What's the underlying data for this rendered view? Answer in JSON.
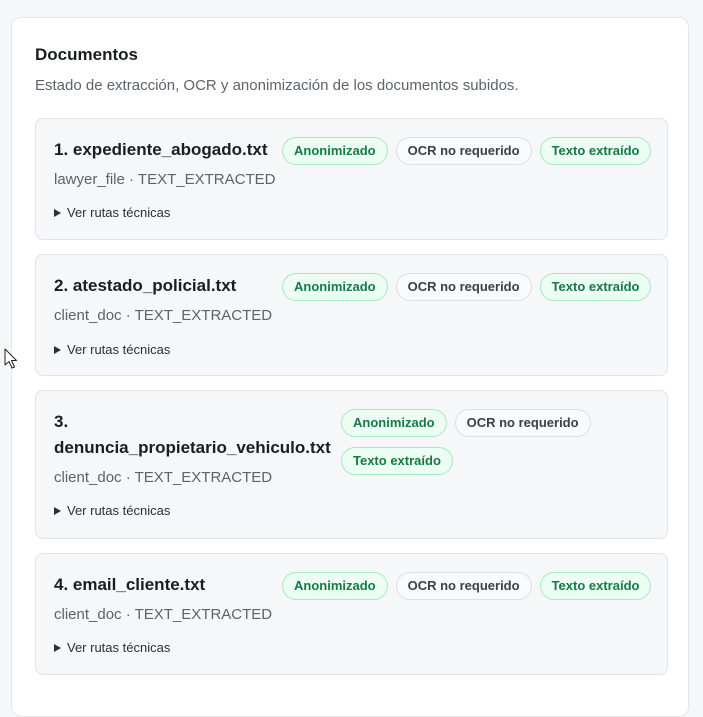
{
  "panel": {
    "title": "Documentos",
    "subtitle": "Estado de extracción, OCR y anonimización de los documentos subidos."
  },
  "documents": [
    {
      "title": "1. expediente_abogado.txt",
      "meta": "lawyer_file · TEXT_EXTRACTED",
      "badges": [
        "Anonimizado",
        "OCR no requerido",
        "Texto extraído"
      ],
      "details": "Ver rutas técnicas"
    },
    {
      "title": "2. atestado_policial.txt",
      "meta": "client_doc · TEXT_EXTRACTED",
      "badges": [
        "Anonimizado",
        "OCR no requerido",
        "Texto extraído"
      ],
      "details": "Ver rutas técnicas"
    },
    {
      "title_line1": "3.",
      "title_line2": "denuncia_propietario_vehiculo.txt",
      "meta": "client_doc · TEXT_EXTRACTED",
      "badges": [
        "Anonimizado",
        "OCR no requerido",
        "Texto extraído"
      ],
      "details": "Ver rutas técnicas"
    },
    {
      "title": "4. email_cliente.txt",
      "meta": "client_doc · TEXT_EXTRACTED",
      "badges": [
        "Anonimizado",
        "OCR no requerido",
        "Texto extraído"
      ],
      "details": "Ver rutas técnicas"
    }
  ],
  "colors": {
    "badge_green_bg": "#ecfdf3",
    "badge_green_text": "#157a47",
    "badge_gray_text": "#3a4047",
    "card_bg": "#f6f7f9"
  }
}
